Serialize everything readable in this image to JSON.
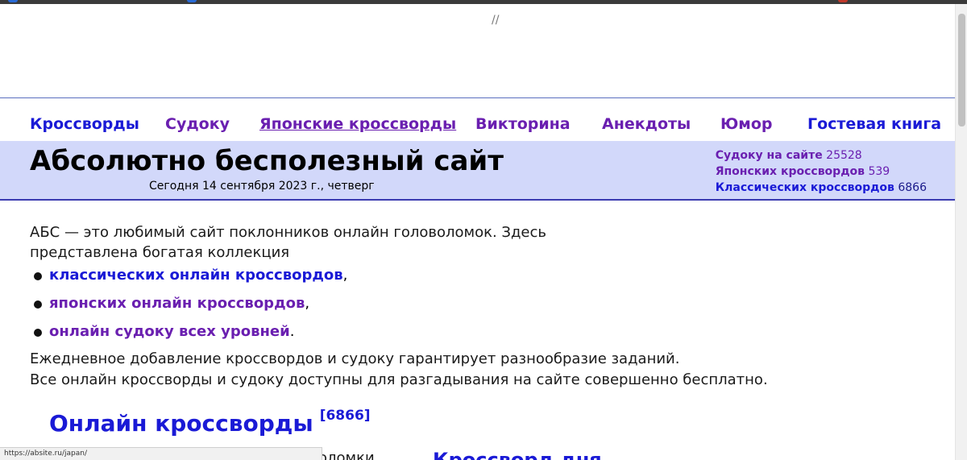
{
  "top_comment": "//",
  "nav": {
    "items": [
      {
        "label": "Кроссворды"
      },
      {
        "label": "Судоку"
      },
      {
        "label": "Японские кроссворды"
      },
      {
        "label": "Викторина"
      },
      {
        "label": "Анекдоты"
      },
      {
        "label": "Юмор"
      },
      {
        "label": "Гостевая книга"
      }
    ]
  },
  "header": {
    "title": "Абсолютно бесполезный сайт",
    "date": "Сегодня 14 сентября 2023 г., четверг",
    "stats": [
      {
        "label": "Судоку на сайте",
        "count": "25528"
      },
      {
        "label": "Японских кроссвордов",
        "count": "539"
      },
      {
        "label": "Классических кроссвордов",
        "count": "6866"
      }
    ]
  },
  "intro": {
    "text": "АБС — это любимый сайт поклонников онлайн головоломок. Здесь представлена богатая коллекция",
    "list": [
      {
        "link": "классических онлайн кроссвордов",
        "suffix": ","
      },
      {
        "link": "японских онлайн кроссвордов",
        "suffix": ","
      },
      {
        "link": "онлайн судоку всех уровней",
        "suffix": "."
      }
    ],
    "line1": "Ежедневное добавление кроссвордов и судоку гарантирует разнообразие заданий.",
    "line2": "Все онлайн кроссворды и судоку доступны для разгадывания на сайте совершенно бесплатно."
  },
  "section": {
    "title": "Онлайн кроссворды",
    "count": "[6866]"
  },
  "partial": {
    "left_text": "оломки",
    "right_heading": "Кроссворд дня"
  },
  "statusbar": {
    "url": "https://absite.ru/japan/"
  },
  "colors": {
    "link_blue": "#1a1ad6",
    "link_visited": "#6a1fb0",
    "banner_bg": "#d2d8fa"
  }
}
